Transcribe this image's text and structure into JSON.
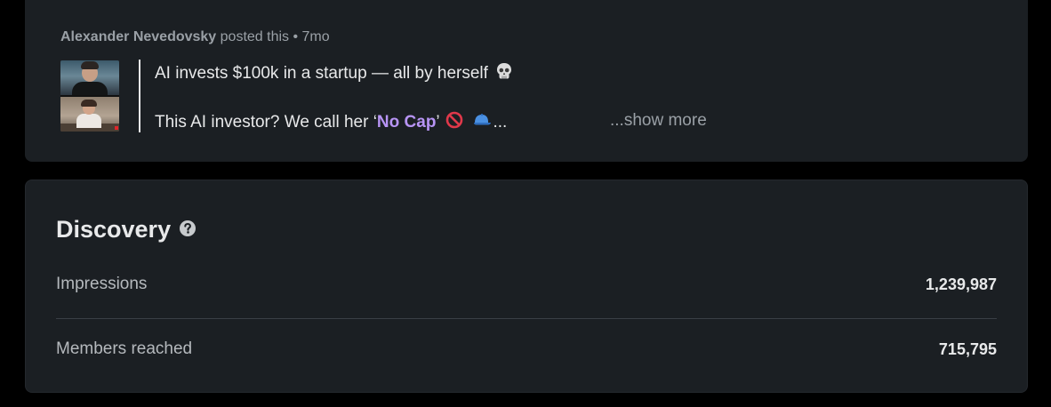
{
  "post": {
    "author": "Alexander Nevedovsky",
    "meta_suffix": " posted this • 7mo",
    "line1_text": "AI invests $100k in a startup — all by herself ",
    "line2_prefix": "This AI investor? We call her ‘",
    "line2_highlight": "No Cap",
    "line2_suffix": "’ ",
    "line2_ellipsis": "...",
    "show_more": "...show more",
    "thumbnail_icon": "video-call-thumbnail"
  },
  "discovery": {
    "title": "Discovery",
    "help_icon": "question-circle-icon",
    "metrics": [
      {
        "label": "Impressions",
        "value": "1,239,987"
      },
      {
        "label": "Members reached",
        "value": "715,795"
      }
    ]
  },
  "colors": {
    "background": "#000000",
    "card": "#1b1f23",
    "text_primary": "#e8e9ea",
    "text_secondary": "#9aa0a6",
    "highlight": "#b794f4"
  }
}
